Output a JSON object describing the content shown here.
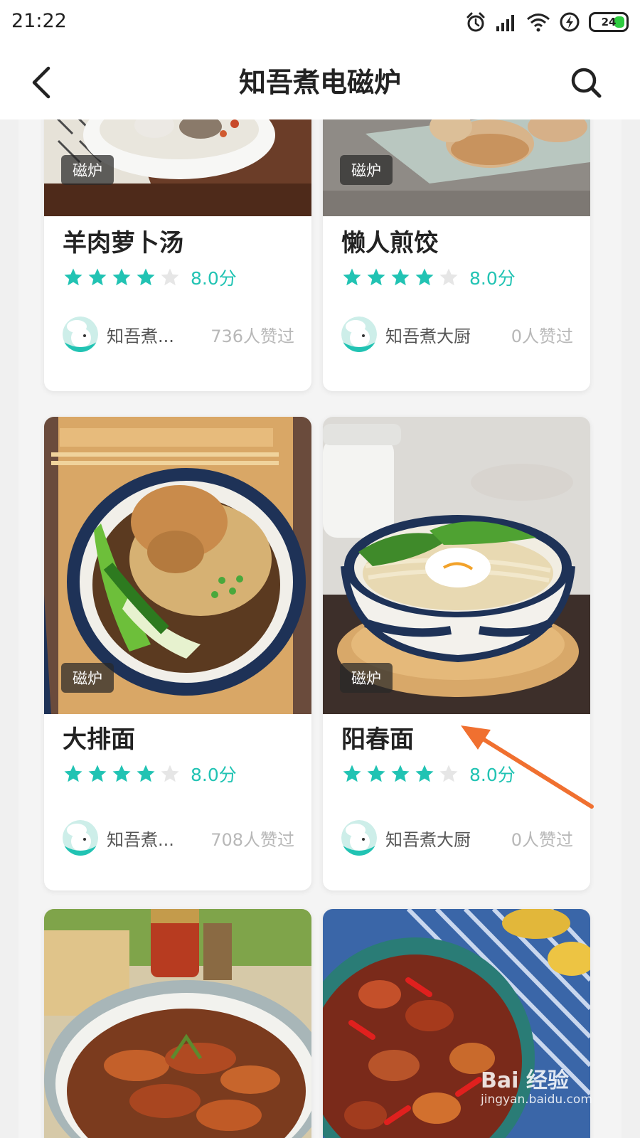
{
  "status_bar": {
    "time": "21:22",
    "battery_level": "24",
    "icons": [
      "alarm-icon",
      "signal-icon",
      "wifi-icon",
      "charging-icon",
      "battery-icon"
    ]
  },
  "nav": {
    "back_icon": "back-arrow-icon",
    "title": "知吾煮电磁炉",
    "search_icon": "search-icon"
  },
  "colors": {
    "accent": "#21c3b3",
    "annotation_arrow": "#f07030"
  },
  "recipes": [
    {
      "tag": "磁炉",
      "title": "羊肉萝卜汤",
      "rating_stars": 4,
      "score": "8.0分",
      "author": "知吾煮...",
      "likes": "736人赞过"
    },
    {
      "tag": "磁炉",
      "title": "懒人煎饺",
      "rating_stars": 4,
      "score": "8.0分",
      "author": "知吾煮大厨",
      "likes": "0人赞过"
    },
    {
      "tag": "磁炉",
      "title": "大排面",
      "rating_stars": 4,
      "score": "8.0分",
      "author": "知吾煮...",
      "likes": "708人赞过"
    },
    {
      "tag": "磁炉",
      "title": "阳春面",
      "rating_stars": 4,
      "score": "8.0分",
      "author": "知吾煮大厨",
      "likes": "0人赞过"
    }
  ],
  "watermark": {
    "brand": "Bai 经验",
    "url": "jingyan.baidu.com"
  }
}
